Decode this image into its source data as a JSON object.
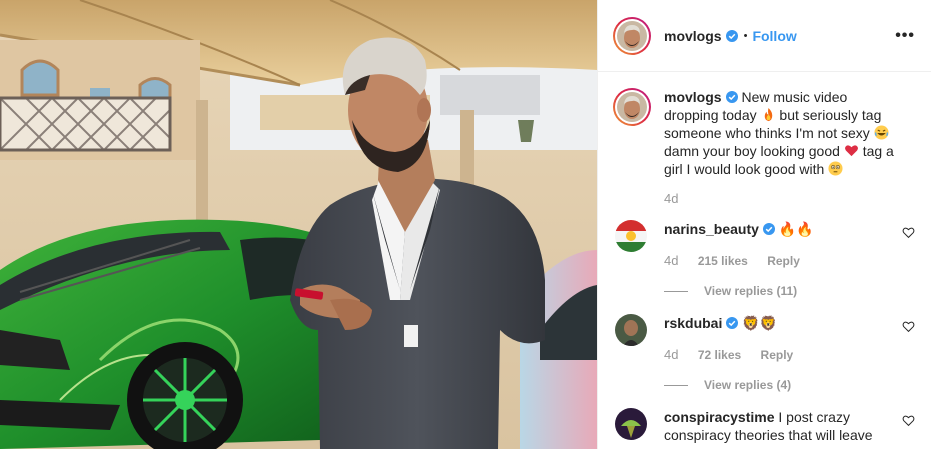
{
  "post": {
    "username": "movlogs",
    "follow_label": "Follow",
    "separator": "•",
    "more_label": "•••"
  },
  "caption": {
    "username": "movlogs",
    "parts": [
      "New music video dropping today",
      "but seriously tag someone who thinks I'm not sexy",
      "damn your boy looking good",
      "tag a girl I would look good with"
    ],
    "age": "4d"
  },
  "comments": [
    {
      "username": "narins_beauty",
      "emoji": "🔥🔥",
      "age": "4d",
      "likes": "215 likes",
      "reply": "Reply",
      "view_replies": "View replies (11)"
    },
    {
      "username": "rskdubai",
      "emoji": "🦁🦁",
      "age": "4d",
      "likes": "72 likes",
      "reply": "Reply",
      "view_replies": "View replies (4)"
    },
    {
      "username": "conspiracystime",
      "text": "I post crazy conspiracy theories that will leave"
    }
  ],
  "colors": {
    "link": "#3897f0",
    "muted": "#999999",
    "verified": "#3897f0"
  }
}
